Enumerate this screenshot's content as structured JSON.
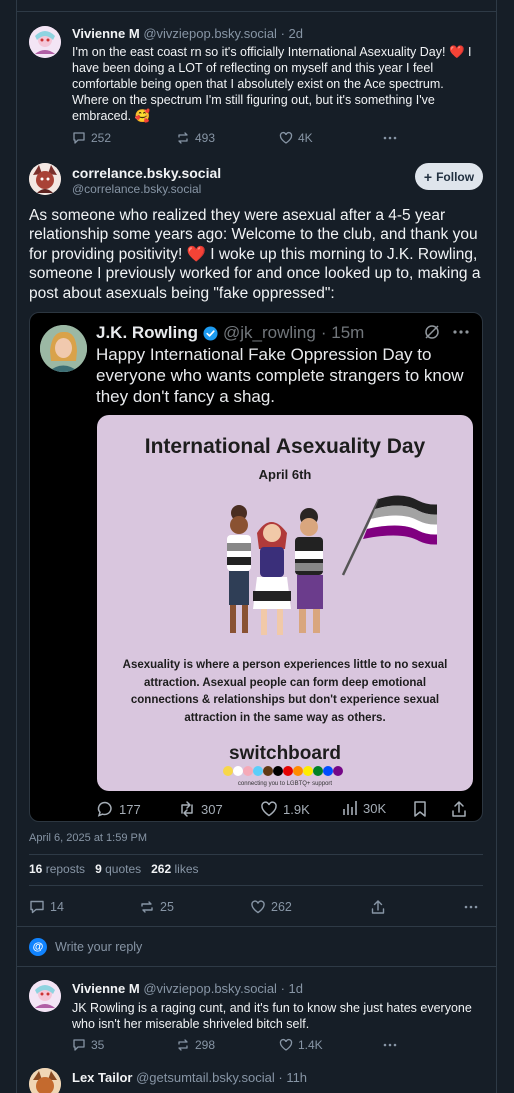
{
  "post1": {
    "display_name": "Vivienne M",
    "handle": "@vivziepop.bsky.social",
    "age": "· 2d",
    "text": "I'm on the east coast rn so it's officially International Asexuality Day! ❤️ I have been doing a LOT of reflecting on myself and this year I feel comfortable being open that I absolutely exist on the Ace spectrum. Where on the spectrum I'm still figuring out, but it's something I've embraced. 🥰",
    "replies": "252",
    "reposts": "493",
    "likes": "4K"
  },
  "main_post": {
    "display_name": "correlance.bsky.social",
    "handle": "@correlance.bsky.social",
    "follow_label": "Follow",
    "text": "As someone who realized they were asexual after a 4-5 year relationship some years ago: Welcome to the club, and thank you for providing positivity! ❤️ I woke up this morning to J.K. Rowling, someone I previously worked for and once looked up to, making a post about asexuals being \"fake oppressed\":",
    "timestamp": "April 6, 2025 at 1:59 PM",
    "reposts_count": "16",
    "reposts_label": "reposts",
    "quotes_count": "9",
    "quotes_label": "quotes",
    "likes_count": "262",
    "likes_label": "likes",
    "replies": "14",
    "reposts": "25",
    "likes": "262"
  },
  "quoted": {
    "display_name": "J.K. Rowling",
    "handle": "@jk_rowling",
    "age": "· 15m",
    "text": "Happy International Fake Oppression Day to everyone who wants complete strangers to know they don't fancy a shag.",
    "card_title": "International Asexuality Day",
    "card_date": "April 6th",
    "card_body": "Asexuality is where a person experiences little to no sexual attraction. Asexual people can form deep emotional connections & relationships but don't experience sexual attraction in the same way as others.",
    "card_brand": "switchboard",
    "card_tagline": "connecting you to LGBTQ+ support",
    "replies": "177",
    "reposts": "307",
    "likes": "1.9K",
    "views": "30K"
  },
  "reply_box": {
    "placeholder": "Write your reply"
  },
  "reply1": {
    "display_name": "Vivienne M",
    "handle": "@vivziepop.bsky.social",
    "age": "· 1d",
    "text": "JK Rowling is a raging cunt, and it's fun to know she just hates everyone who isn't her miserable shriveled bitch self.",
    "replies": "35",
    "reposts": "298",
    "likes": "1.4K"
  },
  "reply2": {
    "display_name": "Lex Tailor",
    "handle": "@getsumtail.bsky.social",
    "age": "· 11h"
  },
  "colors": {
    "background": "#161e27",
    "accent": "#1083fe",
    "muted": "#8795a5"
  }
}
